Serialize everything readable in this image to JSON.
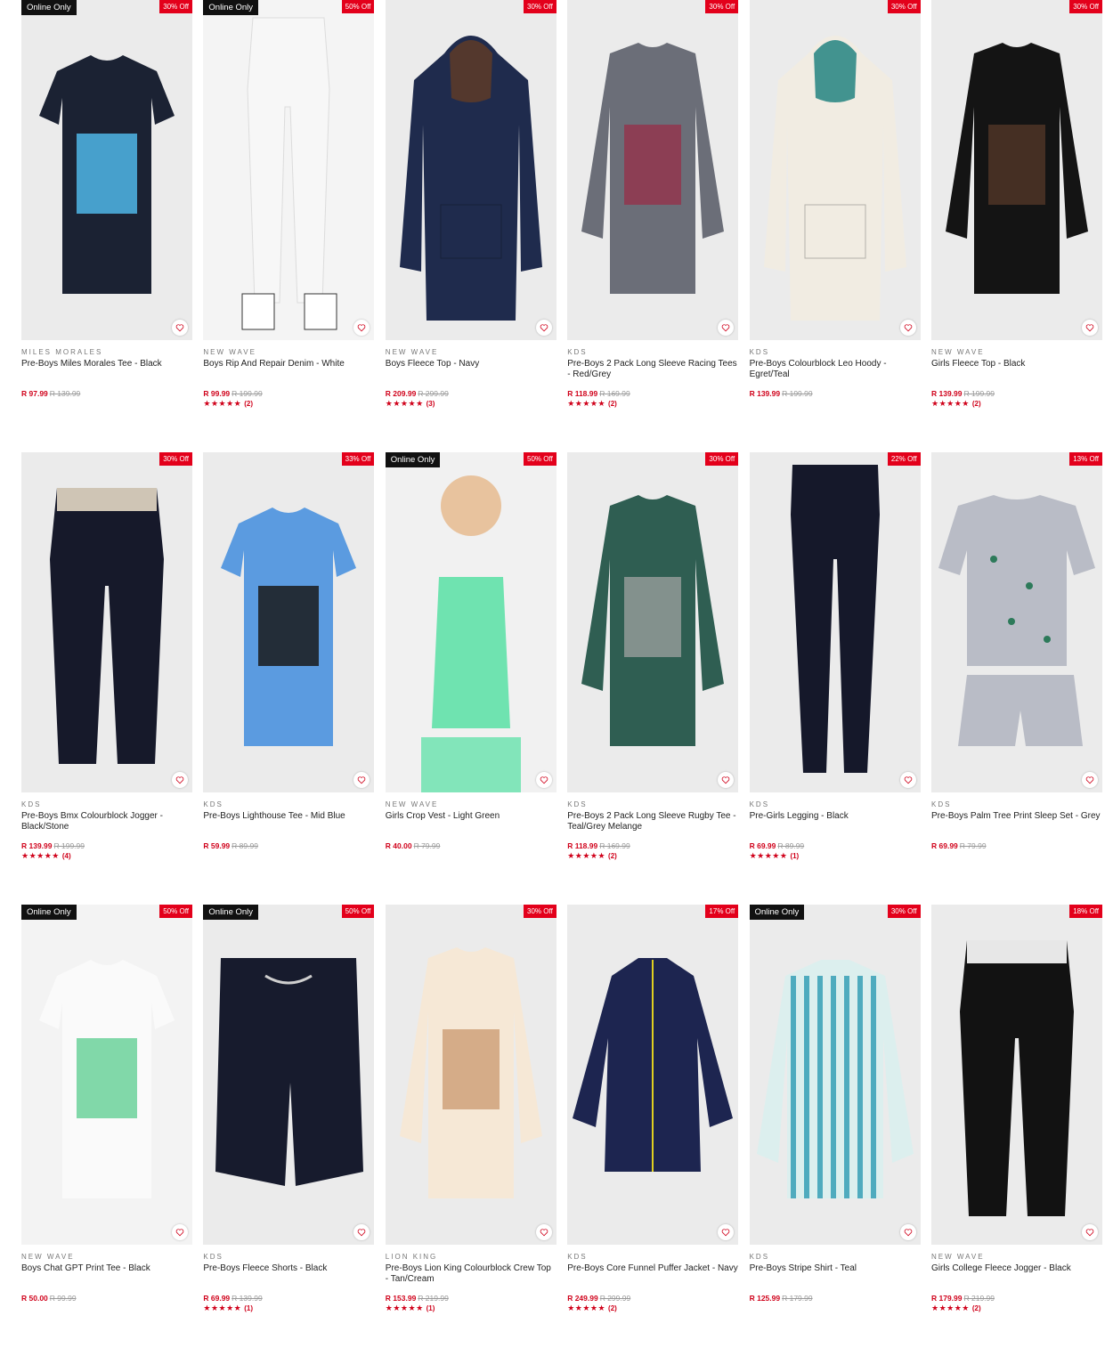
{
  "products": [
    {
      "online_only": "Online Only",
      "discount": "30% Off",
      "brand": "MILES MORALES",
      "name": "Pre-Boys Miles Morales Tee - Black",
      "price": "R 97.99",
      "was": "R 139.99",
      "stars": "",
      "count": "",
      "icon": "tshirt-icon",
      "colors": {
        "bg": "#ebebeb",
        "item": "#1b2233",
        "accent": "#4fb6e8"
      }
    },
    {
      "online_only": "Online Only",
      "discount": "50% Off",
      "brand": "NEW WAVE",
      "name": "Boys Rip And Repair Denim - White",
      "price": "R 99.99",
      "was": "R 199.99",
      "stars": "★★★★★",
      "count": "(2)",
      "icon": "jeans-icon",
      "colors": {
        "bg": "#f4f4f4",
        "item": "#f7f7f7",
        "accent": "#6b4c3a"
      }
    },
    {
      "online_only": "",
      "discount": "30% Off",
      "brand": "NEW WAVE",
      "name": "Boys Fleece Top - Navy",
      "price": "R 209.99",
      "was": "R 299.99",
      "stars": "★★★★★",
      "count": "(3)",
      "icon": "hoodie-icon",
      "colors": {
        "bg": "#ebebeb",
        "item": "#1f2b4d",
        "accent": "#5a3a2a"
      }
    },
    {
      "online_only": "",
      "discount": "30% Off",
      "brand": "KDS",
      "name": "Pre-Boys 2 Pack Long Sleeve Racing Tees - Red/Grey",
      "price": "R 118.99",
      "was": "R 169.99",
      "stars": "★★★★★",
      "count": "(2)",
      "icon": "sweater-icon",
      "colors": {
        "bg": "#ebebeb",
        "item": "#6b6e78",
        "accent": "#9a2944"
      }
    },
    {
      "online_only": "",
      "discount": "30% Off",
      "brand": "KDS",
      "name": "Pre-Boys Colourblock Leo Hoody - Egret/Teal",
      "price": "R 139.99",
      "was": "R 199.99",
      "stars": "",
      "count": "",
      "icon": "hoodie-icon",
      "colors": {
        "bg": "#ebebeb",
        "item": "#f1ece2",
        "accent": "#2f8a86"
      }
    },
    {
      "online_only": "",
      "discount": "30% Off",
      "brand": "NEW WAVE",
      "name": "Girls Fleece Top - Black",
      "price": "R 139.99",
      "was": "R 199.99",
      "stars": "★★★★★",
      "count": "(2)",
      "icon": "sweater-icon",
      "colors": {
        "bg": "#ebebeb",
        "item": "#141414",
        "accent": "#5a3a2a"
      }
    },
    {
      "online_only": "",
      "discount": "30% Off",
      "brand": "KDS",
      "name": "Pre-Boys Bmx Colourblock Jogger - Black/Stone",
      "price": "R 139.99",
      "was": "R 199.99",
      "stars": "★★★★★",
      "count": "(4)",
      "icon": "jogger-icon",
      "colors": {
        "bg": "#ebebeb",
        "item": "#16192a",
        "accent": "#e3d8c4"
      }
    },
    {
      "online_only": "",
      "discount": "33% Off",
      "brand": "KDS",
      "name": "Pre-Boys Lighthouse Tee - Mid Blue",
      "price": "R 59.99",
      "was": "R 89.99",
      "stars": "",
      "count": "",
      "icon": "tshirt-icon",
      "colors": {
        "bg": "#ebebeb",
        "item": "#5b9be0",
        "accent": "#1a1a1a"
      }
    },
    {
      "online_only": "Online Only",
      "discount": "50% Off",
      "brand": "NEW WAVE",
      "name": "Girls Crop Vest - Light Green",
      "price": "R 40.00",
      "was": "R 79.99",
      "stars": "",
      "count": "",
      "icon": "vest-icon",
      "colors": {
        "bg": "#f1f1f1",
        "item": "#6fe3b0",
        "accent": "#c49a6c"
      }
    },
    {
      "online_only": "",
      "discount": "30% Off",
      "brand": "KDS",
      "name": "Pre-Boys 2 Pack Long Sleeve Rugby Tee - Teal/Grey Melange",
      "price": "R 118.99",
      "was": "R 169.99",
      "stars": "★★★★★",
      "count": "(2)",
      "icon": "sweater-icon",
      "colors": {
        "bg": "#ebebeb",
        "item": "#2f5e52",
        "accent": "#a6a6a6"
      }
    },
    {
      "online_only": "",
      "discount": "22% Off",
      "brand": "KDS",
      "name": "Pre-Girls Legging - Black",
      "price": "R 69.99",
      "was": "R 89.99",
      "stars": "★★★★★",
      "count": "(1)",
      "icon": "legging-icon",
      "colors": {
        "bg": "#ebebeb",
        "item": "#15182a",
        "accent": "#15182a"
      }
    },
    {
      "online_only": "",
      "discount": "13% Off",
      "brand": "KDS",
      "name": "Pre-Boys Palm Tree Print Sleep Set - Grey",
      "price": "R 69.99",
      "was": "R 79.99",
      "stars": "",
      "count": "",
      "icon": "sleepset-icon",
      "colors": {
        "bg": "#ebebeb",
        "item": "#b9bcc6",
        "accent": "#2d7a5a"
      }
    },
    {
      "online_only": "Online Only",
      "discount": "50% Off",
      "brand": "NEW WAVE",
      "name": "Boys Chat GPT Print Tee - Black",
      "price": "R 50.00",
      "was": "R 99.99",
      "stars": "",
      "count": "",
      "icon": "tshirt-icon",
      "colors": {
        "bg": "#f3f3f3",
        "item": "#fafafa",
        "accent": "#6bd19a"
      }
    },
    {
      "online_only": "Online Only",
      "discount": "50% Off",
      "brand": "KDS",
      "name": "Pre-Boys Fleece Shorts - Black",
      "price": "R 69.99",
      "was": "R 139.99",
      "stars": "★★★★★",
      "count": "(1)",
      "icon": "shorts-icon",
      "colors": {
        "bg": "#ebebeb",
        "item": "#171b2d",
        "accent": "#cfcfcf"
      }
    },
    {
      "online_only": "",
      "discount": "30% Off",
      "brand": "LION KING",
      "name": "Pre-Boys Lion King Colourblock Crew Top - Tan/Cream",
      "price": "R 153.99",
      "was": "R 219.99",
      "stars": "★★★★★",
      "count": "(1)",
      "icon": "sweater-icon",
      "colors": {
        "bg": "#ebebeb",
        "item": "#f6e8d6",
        "accent": "#c79366"
      }
    },
    {
      "online_only": "",
      "discount": "17% Off",
      "brand": "KDS",
      "name": "Pre-Boys Core Funnel Puffer Jacket - Navy",
      "price": "R 249.99",
      "was": "R 299.99",
      "stars": "★★★★★",
      "count": "(2)",
      "icon": "jacket-icon",
      "colors": {
        "bg": "#ebebeb",
        "item": "#1d2550",
        "accent": "#e0d020"
      }
    },
    {
      "online_only": "Online Only",
      "discount": "30% Off",
      "brand": "KDS",
      "name": "Pre-Boys Stripe Shirt - Teal",
      "price": "R 125.99",
      "was": "R 179.99",
      "stars": "",
      "count": "",
      "icon": "shirt-icon",
      "colors": {
        "bg": "#ebebeb",
        "item": "#dcefee",
        "accent": "#2c9ab2"
      }
    },
    {
      "online_only": "",
      "discount": "18% Off",
      "brand": "NEW WAVE",
      "name": "Girls College Fleece Jogger - Black",
      "price": "R 179.99",
      "was": "R 219.99",
      "stars": "★★★★★",
      "count": "(2)",
      "icon": "jogger-icon",
      "colors": {
        "bg": "#ebebeb",
        "item": "#121212",
        "accent": "#ffffff"
      }
    }
  ]
}
